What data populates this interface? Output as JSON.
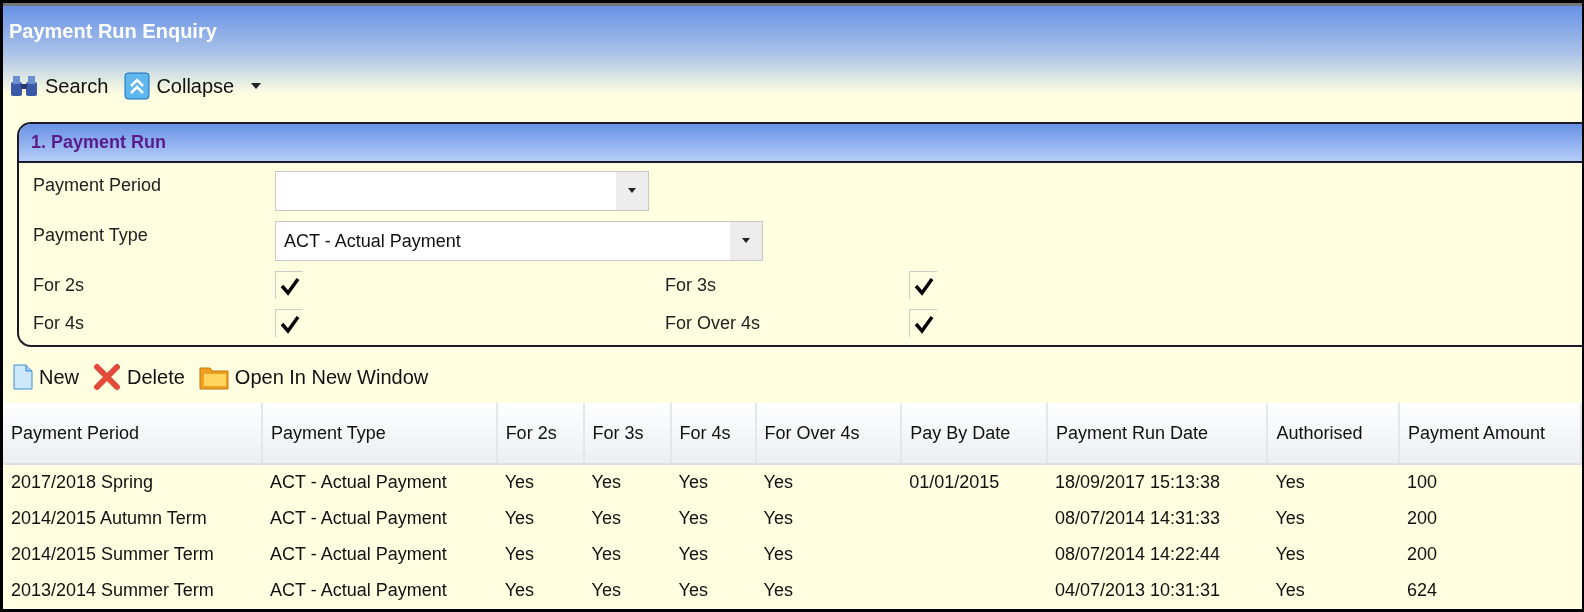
{
  "window": {
    "title": "Payment Run Enquiry"
  },
  "toolbar": [
    {
      "kind": "search",
      "label": "Search"
    },
    {
      "kind": "collapse",
      "label": "Collapse",
      "dropdown": true
    }
  ],
  "panel": {
    "title": "1. Payment Run",
    "fields": [
      {
        "label": "Payment Period",
        "kind": "select"
      },
      {
        "label": "Payment Type",
        "kind": "select",
        "value": "ACT - Actual Payment"
      }
    ],
    "checkboxes": [
      {
        "label": "For 2s",
        "checked": true
      },
      {
        "label": "For 3s",
        "checked": true
      },
      {
        "label": "For 4s",
        "checked": true
      },
      {
        "label": "For Over 4s",
        "checked": true
      }
    ]
  },
  "actions": [
    {
      "kind": "new",
      "label": "New"
    },
    {
      "kind": "delete",
      "label": "Delete"
    },
    {
      "kind": "open",
      "label": "Open In New Window"
    }
  ],
  "table": {
    "columns": [
      "Payment Period",
      "Payment Type",
      "For 2s",
      "For 3s",
      "For 4s",
      "For Over 4s",
      "Pay By Date",
      "Payment Run Date",
      "Authorised",
      "Payment Amount"
    ],
    "rows": [
      [
        "2017/2018 Spring",
        "ACT - Actual Payment",
        "Yes",
        "Yes",
        "Yes",
        "Yes",
        "01/01/2015",
        "18/09/2017 15:13:38",
        "Yes",
        "100"
      ],
      [
        "2014/2015 Autumn Term",
        "ACT - Actual Payment",
        "Yes",
        "Yes",
        "Yes",
        "Yes",
        "",
        "08/07/2014 14:31:33",
        "Yes",
        "200"
      ],
      [
        "2014/2015 Summer Term",
        "ACT - Actual Payment",
        "Yes",
        "Yes",
        "Yes",
        "Yes",
        "",
        "08/07/2014 14:22:44",
        "Yes",
        "200"
      ],
      [
        "2013/2014 Summer Term",
        "ACT - Actual Payment",
        "Yes",
        "Yes",
        "Yes",
        "Yes",
        "",
        "04/07/2013 10:31:31",
        "Yes",
        "624"
      ]
    ]
  }
}
